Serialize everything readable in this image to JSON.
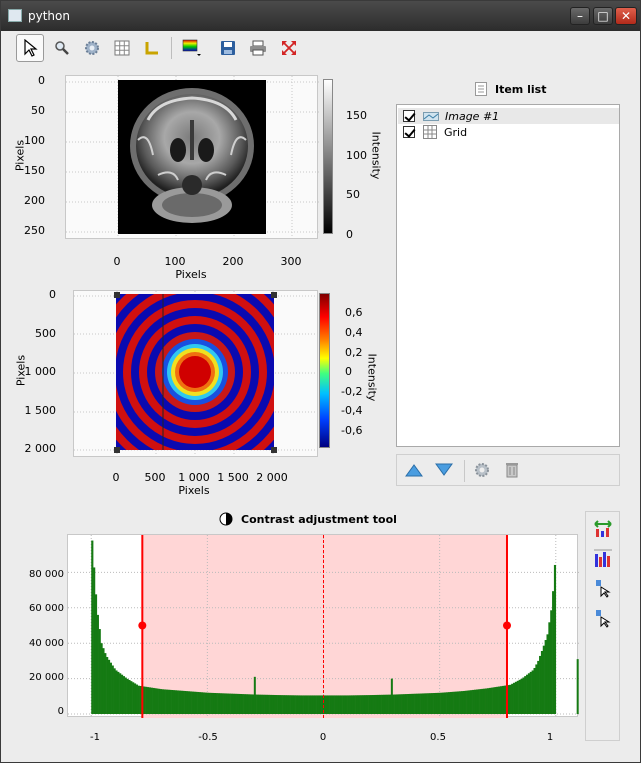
{
  "window": {
    "title": "python"
  },
  "toolbar": {
    "icons": [
      "select-arrow-icon",
      "zoom-icon",
      "gear-icon",
      "grid-icon",
      "axes-icon",
      "colormap-icon",
      "save-icon",
      "print-icon",
      "fullscreen-icon"
    ]
  },
  "plot1": {
    "xlabel": "Pixels",
    "ylabel": "Pixels",
    "colorbar_label": "Intensity",
    "x_ticks": [
      "0",
      "100",
      "200",
      "300"
    ],
    "y_ticks": [
      "0",
      "50",
      "100",
      "150",
      "200",
      "250"
    ],
    "colorbar_ticks": [
      "150",
      "100",
      "50",
      "0"
    ]
  },
  "plot2": {
    "xlabel": "Pixels",
    "ylabel": "Pixels",
    "colorbar_label": "Intensity",
    "x_ticks": [
      "0",
      "500",
      "1 000",
      "1 500",
      "2 000"
    ],
    "y_ticks": [
      "0",
      "500",
      "1 000",
      "1 500",
      "2 000"
    ],
    "colorbar_ticks": [
      "0,6",
      "0,4",
      "0,2",
      "0",
      "-0,2",
      "-0,4",
      "-0,6"
    ]
  },
  "item_list": {
    "title": "Item list",
    "items": [
      {
        "label": "Image #1",
        "checked": true,
        "selected": true
      },
      {
        "label": "Grid",
        "checked": true,
        "selected": false
      }
    ]
  },
  "contrast": {
    "title": "Contrast adjustment tool",
    "chart_data": {
      "type": "bar",
      "x_ticks": [
        "-1",
        "-0.5",
        "0",
        "0.5",
        "1"
      ],
      "y_ticks": [
        "80 000",
        "60 000",
        "40 000",
        "20 000",
        "0"
      ],
      "xlim": [
        -1.1,
        1.1
      ],
      "ylim": [
        0,
        100000
      ],
      "range_min": -0.78,
      "range_max": 0.79,
      "center": 0,
      "bins_x": [
        -1.0,
        -0.98,
        -0.96,
        -0.94,
        -0.92,
        -0.9,
        -0.85,
        -0.8,
        -0.7,
        -0.6,
        -0.5,
        -0.4,
        -0.3,
        -0.2,
        -0.1,
        0,
        0.1,
        0.2,
        0.3,
        0.4,
        0.5,
        0.6,
        0.7,
        0.8,
        0.85,
        0.9,
        0.92,
        0.94,
        0.96,
        0.98,
        1.0
      ],
      "bins_y": [
        98000,
        60000,
        40000,
        33000,
        29000,
        25000,
        20000,
        16000,
        14000,
        13000,
        12000,
        11500,
        11000,
        10700,
        10500,
        10500,
        10500,
        10700,
        11000,
        11500,
        12000,
        13000,
        14500,
        16500,
        20000,
        25000,
        30000,
        37000,
        45000,
        62000,
        99000
      ],
      "spikes": [
        {
          "x": -0.3,
          "y": 21000
        },
        {
          "x": 0.29,
          "y": 20000
        },
        {
          "x": 1.09,
          "y": 31000
        }
      ]
    }
  },
  "colors": {
    "accent": "#ff0000",
    "histogram": "#157a13",
    "range_fill": "#ffd6d6"
  }
}
